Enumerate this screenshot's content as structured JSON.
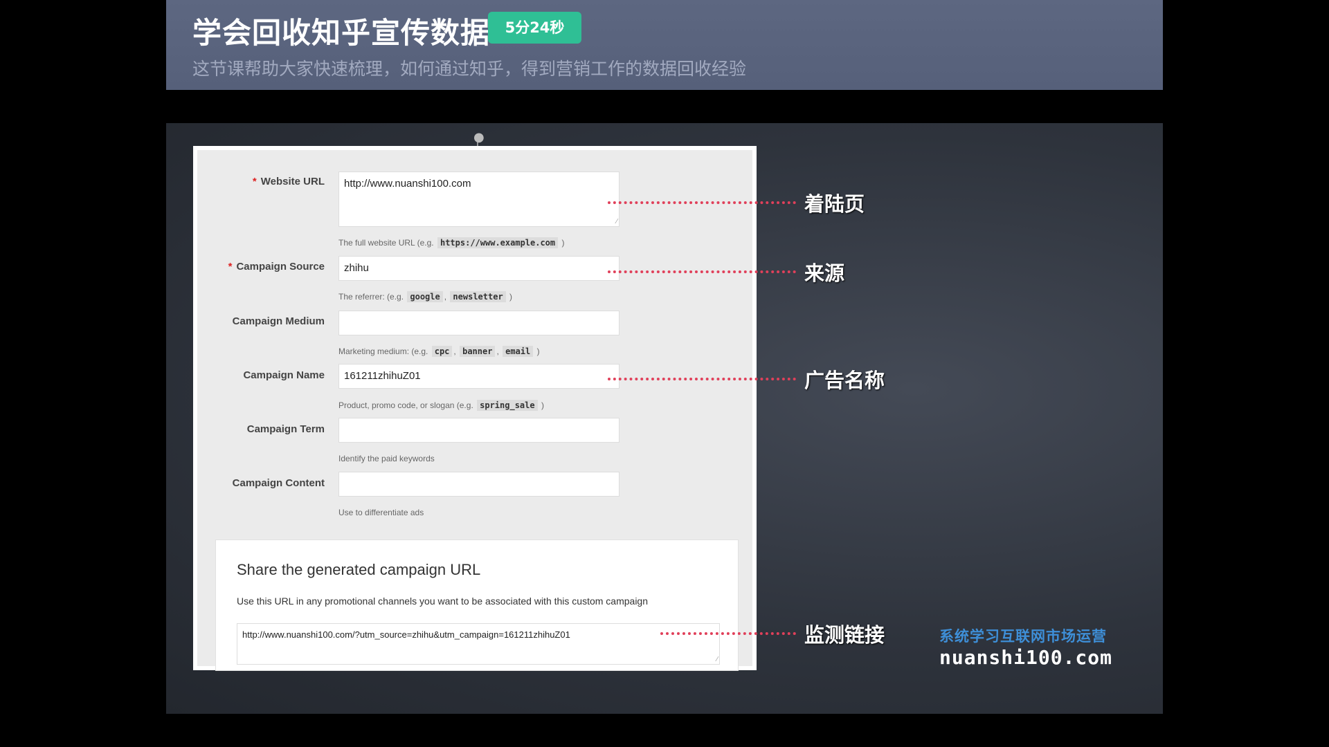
{
  "header": {
    "title": "学会回收知乎宣传数据",
    "badge": "5分24秒",
    "subtitle": "这节课帮助大家快速梳理，如何通过知乎，得到营销工作的数据回收经验"
  },
  "form": {
    "website_url": {
      "required_mark": "*",
      "label": "Website URL",
      "value": "http://www.nuanshi100.com",
      "hint_prefix": "The full website URL (e.g.",
      "hint_code": "https://www.example.com",
      "hint_suffix": ")"
    },
    "campaign_source": {
      "required_mark": "*",
      "label": "Campaign Source",
      "value": "zhihu",
      "hint_prefix": "The referrer: (e.g.",
      "hint_code_1": "google",
      "hint_sep": ",",
      "hint_code_2": "newsletter",
      "hint_suffix": ")"
    },
    "campaign_medium": {
      "label": "Campaign Medium",
      "value": "",
      "hint_prefix": "Marketing medium: (e.g.",
      "hint_code_1": "cpc",
      "hint_sep_1": ",",
      "hint_code_2": "banner",
      "hint_sep_2": ",",
      "hint_code_3": "email",
      "hint_suffix": ")"
    },
    "campaign_name": {
      "label": "Campaign Name",
      "value": "161211zhihuZ01",
      "hint_prefix": "Product, promo code, or slogan (e.g.",
      "hint_code": "spring_sale",
      "hint_suffix": ")"
    },
    "campaign_term": {
      "label": "Campaign Term",
      "value": "",
      "hint": "Identify the paid keywords"
    },
    "campaign_content": {
      "label": "Campaign Content",
      "value": "",
      "hint": "Use to differentiate ads"
    }
  },
  "share": {
    "title": "Share the generated campaign URL",
    "description": "Use this URL in any promotional channels you want to be associated with this custom campaign",
    "url": "http://www.nuanshi100.com/?utm_source=zhihu&utm_campaign=161211zhihuZ01"
  },
  "callouts": {
    "landing_page": "着陆页",
    "source": "来源",
    "ad_name": "广告名称",
    "tracking_link": "监测链接"
  },
  "watermark": {
    "slogan": "系统学习互联网市场运营",
    "site": "nuanshi100.com"
  },
  "colors": {
    "badge": "#2fbf95",
    "callout_dots": "#e0405a",
    "watermark_blue": "#3e8fd8"
  }
}
